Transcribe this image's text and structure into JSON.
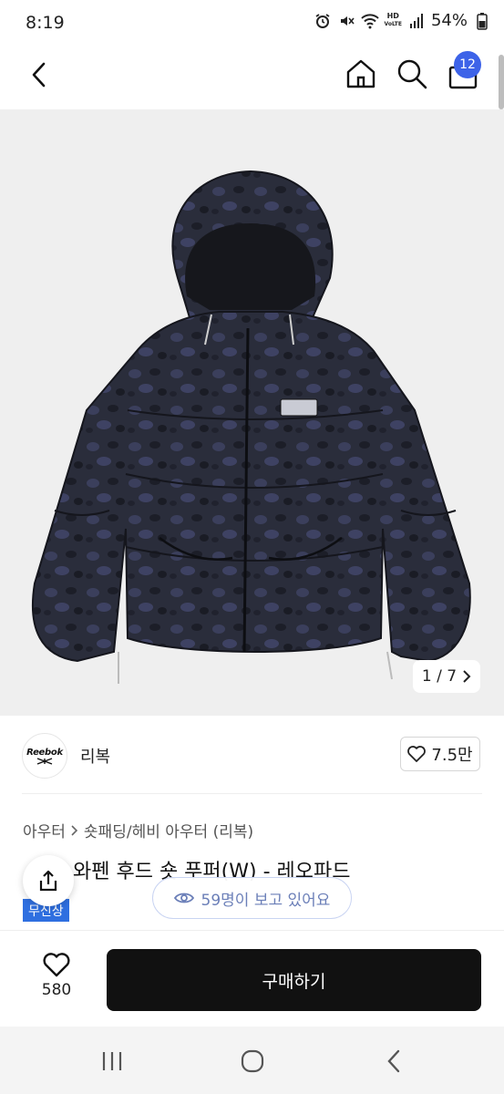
{
  "status_bar": {
    "time": "8:19",
    "hd_label_top": "HD",
    "hd_label_bottom": "VoLTE",
    "battery": "54%"
  },
  "header": {
    "cart_count": "12"
  },
  "gallery": {
    "counter": "1 / 7"
  },
  "brand": {
    "logo_text": "Reebok",
    "name": "리복",
    "wish_count": "7.5만"
  },
  "breadcrumb": {
    "category": "아우터",
    "subcategory": "숏패딩/헤비 아우터 (리복)"
  },
  "product": {
    "title": "와펜 후드 숏 푸퍼(W) - 레오파드",
    "badge": "무신상"
  },
  "viewers": {
    "text": "59명이 보고 있어요"
  },
  "bottom_bar": {
    "like_count": "580",
    "buy_label": "구매하기"
  },
  "colors": {
    "accent": "#3d63e8",
    "badge_blue": "#2f6fe0",
    "buy_button": "#111111"
  }
}
